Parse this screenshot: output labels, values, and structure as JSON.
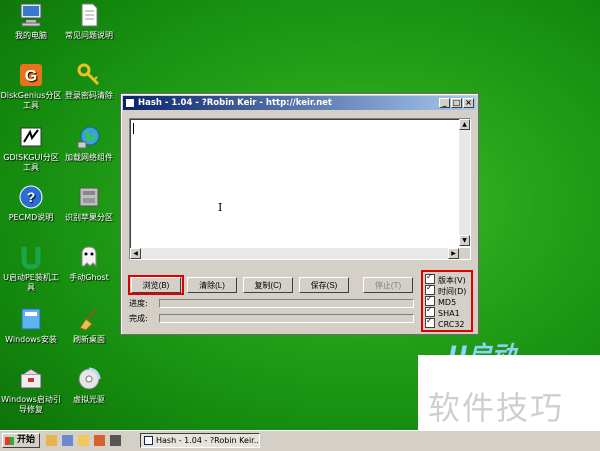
{
  "desktop": {
    "icons": [
      {
        "label": "我的电脑"
      },
      {
        "label": "常见问题说明"
      },
      {
        "label": "DiskGenius分区工具"
      },
      {
        "label": "登录密码清除"
      },
      {
        "label": "GDISKGUI分区工具"
      },
      {
        "label": "加载网络组件"
      },
      {
        "label": "PECMD说明"
      },
      {
        "label": "识别苹果分区"
      },
      {
        "label": "U启动PE装机工具"
      },
      {
        "label": "手动Ghost"
      },
      {
        "label": "Windows安装"
      },
      {
        "label": "刷新桌面"
      },
      {
        "label": "Windows启动引导修复"
      },
      {
        "label": "虚拟光驱"
      }
    ]
  },
  "window": {
    "title": "Hash - 1.04 - ?Robin Keir - http://keir.net",
    "buttons": {
      "browse": "浏览(B)",
      "clear": "清除(L)",
      "copy": "复制(C)",
      "save": "保存(S)",
      "stop": "停止(T)"
    },
    "progress_label": "进度:",
    "complete_label": "完成:",
    "progress_value": 0,
    "complete_value": 0,
    "options": [
      {
        "label": "版本(V)",
        "checked": true
      },
      {
        "label": "时间(D)",
        "checked": true
      },
      {
        "label": "MD5",
        "checked": true
      },
      {
        "label": "SHA1",
        "checked": true
      },
      {
        "label": "CRC32",
        "checked": true
      }
    ]
  },
  "watermark": "软件技巧",
  "logo_text": "U启动",
  "taskbar": {
    "start_label": "开始",
    "task_label": "Hash - 1.04 - ?Robin Keir..."
  },
  "colors": {
    "desktop_green": "#26a21a",
    "title_blue": "#0a246a",
    "highlight_red": "#e00000"
  }
}
